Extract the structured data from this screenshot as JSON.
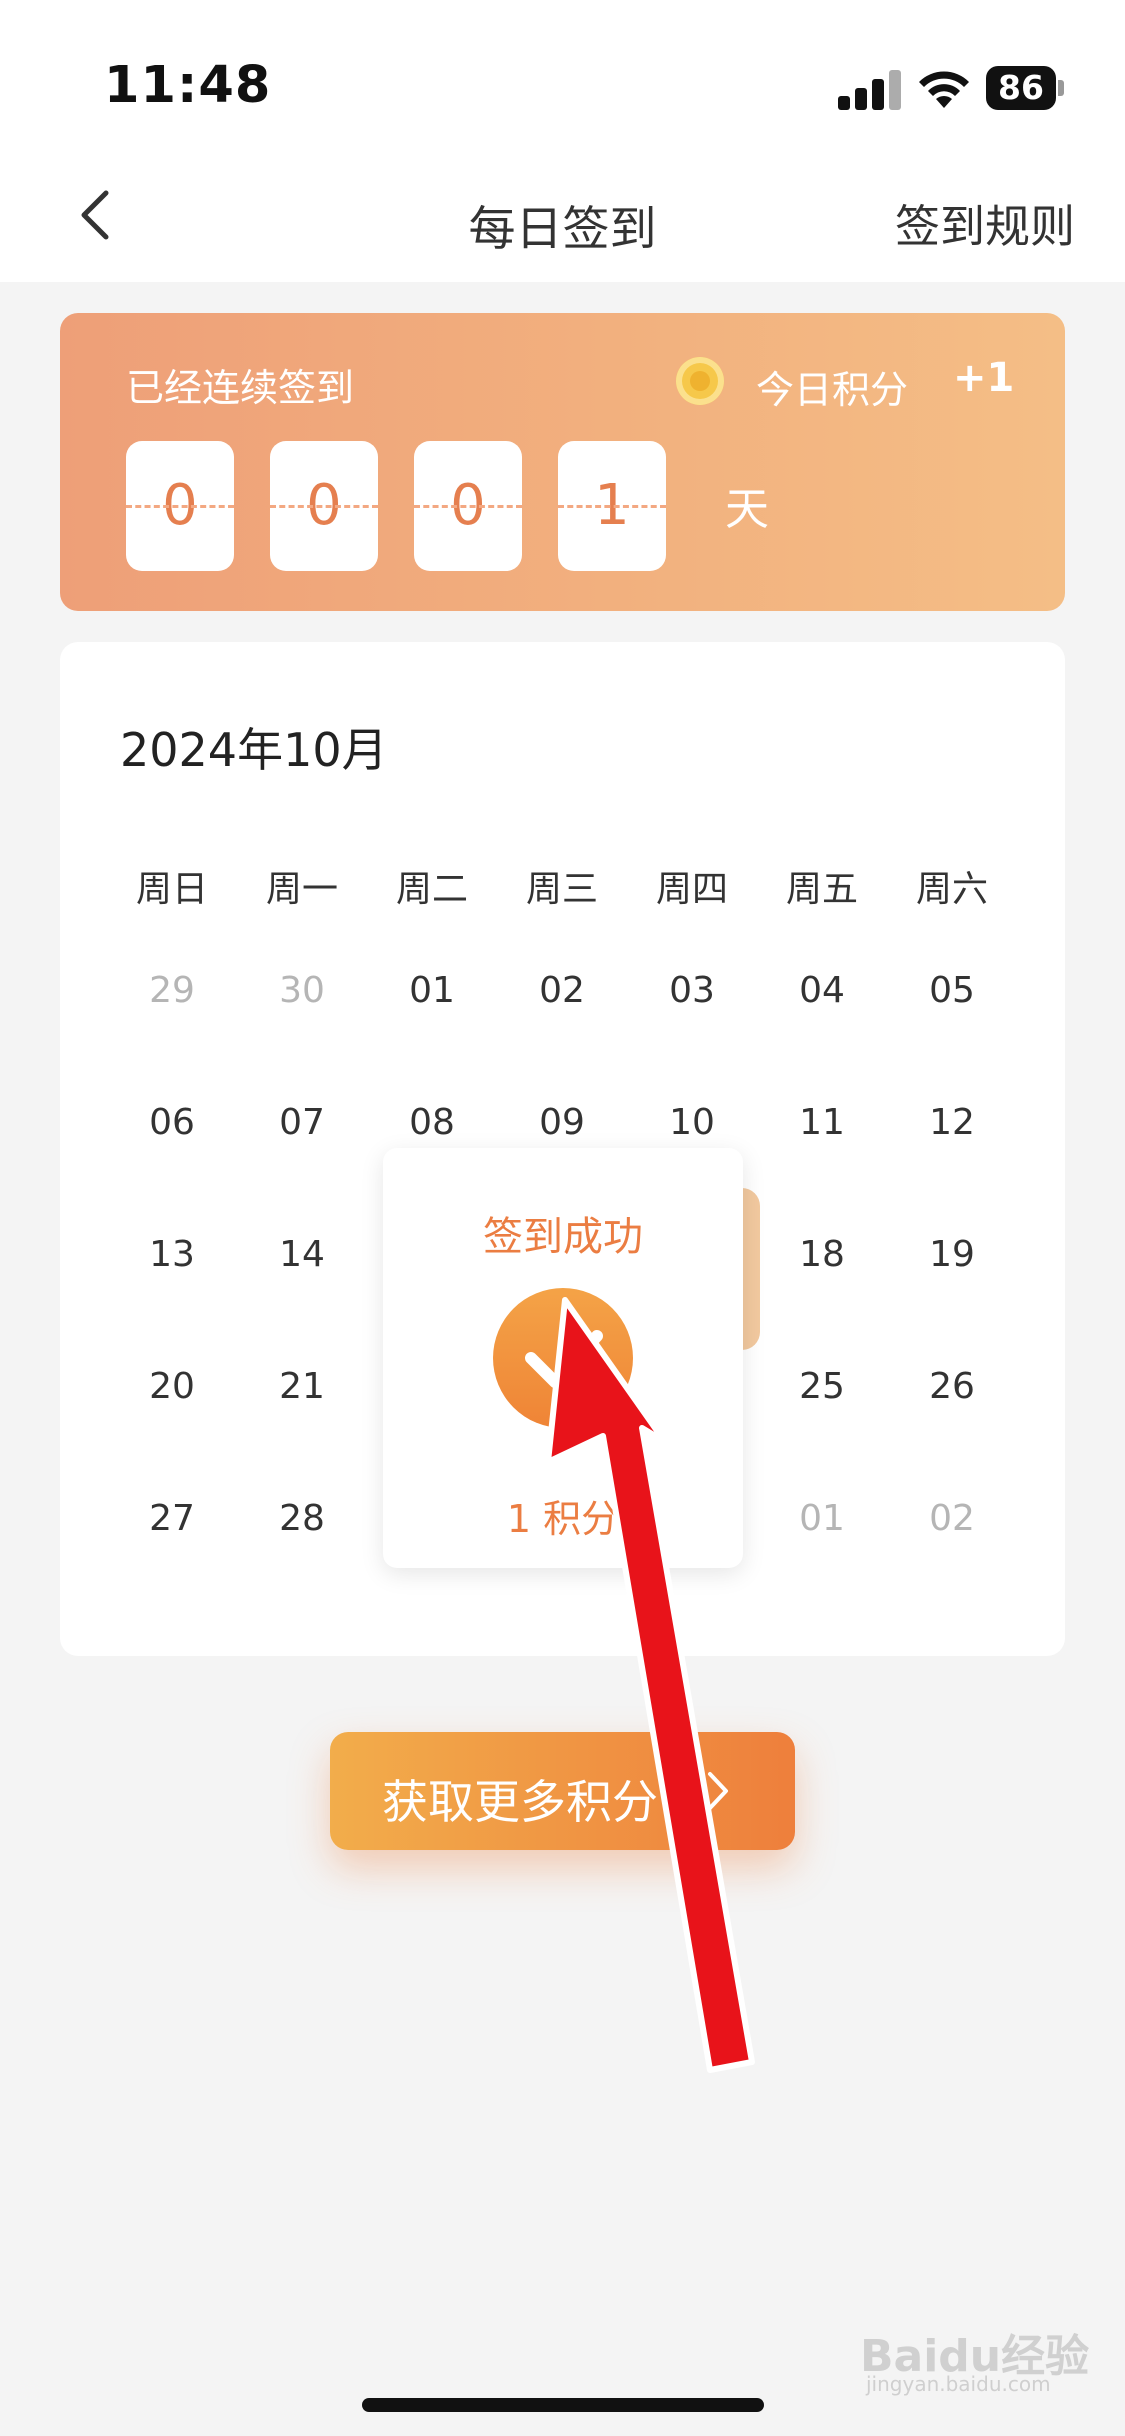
{
  "status_bar": {
    "time": "11:48",
    "battery": "86"
  },
  "header": {
    "title": "每日签到",
    "rules": "签到规则"
  },
  "streak": {
    "label": "已经连续签到",
    "today_label": "今日积分",
    "today_value": "+1",
    "digits": [
      "0",
      "0",
      "0",
      "1"
    ],
    "unit": "天"
  },
  "calendar": {
    "month": "2024年10月",
    "weekdays": [
      "周日",
      "周一",
      "周二",
      "周三",
      "周四",
      "周五",
      "周六"
    ],
    "rows": [
      [
        "29",
        "30",
        "01",
        "02",
        "03",
        "04",
        "05"
      ],
      [
        "06",
        "07",
        "08",
        "09",
        "10",
        "11",
        "12"
      ],
      [
        "13",
        "14",
        "",
        "",
        "",
        "18",
        "19"
      ],
      [
        "20",
        "21",
        "",
        "",
        "",
        "25",
        "26"
      ],
      [
        "27",
        "28",
        "",
        "",
        "",
        "01",
        "02"
      ]
    ]
  },
  "popup": {
    "title": "签到成功",
    "points": "1 积分"
  },
  "cta": {
    "label": "获取更多积分"
  },
  "watermark": {
    "logo": "Baidu经验",
    "url": "jingyan.baidu.com"
  },
  "colors": {
    "accent": "#eb7d42",
    "annotation_arrow": "#e8131a"
  }
}
